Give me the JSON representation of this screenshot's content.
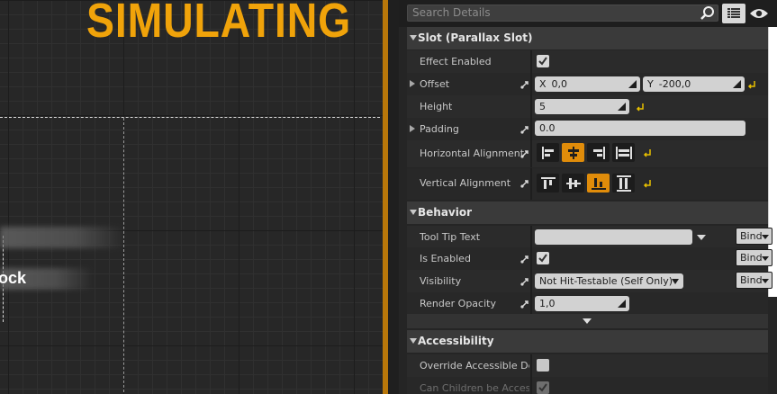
{
  "viewport": {
    "banner_text": "SIMULATING",
    "widget_text": "ock"
  },
  "details": {
    "search_placeholder": "Search Details",
    "categories": {
      "slot": "Slot (Parallax Slot)",
      "behavior": "Behavior",
      "accessibility": "Accessibility"
    },
    "slot": {
      "effect_enabled_label": "Effect Enabled",
      "effect_enabled": true,
      "offset_label": "Offset",
      "offset_x_label": "X",
      "offset_x": "0,0",
      "offset_y_label": "Y",
      "offset_y": "-200,0",
      "height_label": "Height",
      "height": "5",
      "padding_label": "Padding",
      "padding": "0.0",
      "h_align_label": "Horizontal Alignment",
      "h_align_selected": "center",
      "v_align_label": "Vertical Alignment",
      "v_align_selected": "bottom"
    },
    "behavior": {
      "tooltip_label": "Tool Tip Text",
      "tooltip_value": "",
      "is_enabled_label": "Is Enabled",
      "is_enabled": true,
      "visibility_label": "Visibility",
      "visibility_value": "Not Hit-Testable (Self Only)",
      "render_opacity_label": "Render Opacity",
      "render_opacity": "1,0",
      "bind_label": "Bind"
    },
    "accessibility": {
      "override_label": "Override Accessible Defaults",
      "override": false,
      "children_label": "Can Children be Accessible",
      "children": true
    }
  },
  "colors": {
    "accent": "#f0a30a",
    "reset_arrow": "#e8c000"
  }
}
